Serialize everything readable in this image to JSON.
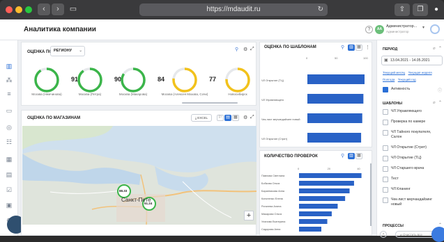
{
  "browser": {
    "url": "https://mdaudit.ru",
    "reload_icon": "reload-icon"
  },
  "header": {
    "title": "Аналитика компании",
    "help": "?",
    "avatar_initials": "AA",
    "user_name": "Администратор...",
    "user_role": "Администратор"
  },
  "region_card": {
    "title_prefix": "ОЦЕНКА ПО",
    "dropdown_value": "РЕГИОНУ",
    "gauges": [
      {
        "value": 91,
        "label": "Москва (Немчинова)",
        "color": "#3bb54a",
        "fraction": 0.91
      },
      {
        "value": 90,
        "label": "Москва (Петра)",
        "color": "#3bb54a",
        "fraction": 0.9
      },
      {
        "value": 84,
        "label": "Москва (Макарова)",
        "color": "#3bb54a",
        "fraction": 0.84
      },
      {
        "value": 77,
        "label": "Москва (Алексея Мазова, Сочи)",
        "color": "#f2c21b",
        "fraction": 0.77
      },
      {
        "value": 76,
        "label": "Новосибирск",
        "color": "#f2c21b",
        "fraction": 0.76
      }
    ]
  },
  "stores_card": {
    "title": "ОЦЕНКА ПО МАГАЗИНАМ",
    "excel_label": "EXCEL",
    "map_labels": {
      "city": "Санкт-Пете",
      "marker1": "88.33",
      "marker2": "51.24",
      "zoom_in": "+"
    }
  },
  "templates_card": {
    "title": "ОЦЕНКА ПО ШАБЛОНАМ",
    "ticks": [
      "0",
      "50",
      "100"
    ],
    "chart_data": {
      "type": "bar",
      "orientation": "horizontal",
      "categories": [
        "ЧЛ Открытие (ТЦ)",
        "ЧЛ Управляющего",
        "Чек-лист мерчандайзинг новый",
        "ЧЛ Открытие (Стрит)"
      ],
      "values": [
        100,
        98,
        96,
        94
      ],
      "xlim": [
        0,
        100
      ]
    }
  },
  "checks_card": {
    "title": "КОЛИЧЕСТВО ПРОВЕРОК",
    "ticks": [
      "0",
      "20",
      "40"
    ],
    "chart_data": {
      "type": "bar",
      "orientation": "horizontal",
      "categories": [
        "Павлова Светлана",
        "Бобкова Ольга",
        "Баранникова Анна",
        "Кононенко Елена",
        "Рогалева Алина",
        "Макарова Ольга",
        "Уланова Екатерина",
        "Сидорова Анна"
      ],
      "values": [
        42,
        37,
        34,
        31,
        26,
        22,
        19,
        15
      ],
      "xlim": [
        0,
        45
      ]
    }
  },
  "filters": {
    "period_title": "ПЕРИОД",
    "date_range": "13.04.2021 - 14.05.2021",
    "quick_links": [
      "Текущий месяц",
      "Текущая неделя",
      "Полгода",
      "Текущий год"
    ],
    "active_label": "Активность",
    "templates_title": "ШАБЛОНЫ",
    "templates": [
      "ЧЛ Управляющего",
      "Проверка по камере",
      "ЧЛ Тайного покупателя, Салон",
      "ЧЛ Открытие (Стрит)",
      "ЧЛ Открытие (ТЦ)",
      "ЧЛ Старшего врача",
      "Тест",
      "ЧЛ Кланинг",
      "Чек-лист мерчандайзинг новый"
    ],
    "processes_title": "ПРОЦЕССЫ",
    "clear_label": "Очистить все"
  },
  "colors": {
    "accent": "#2a6fd6",
    "bar": "#2962c6",
    "green": "#3bb54a",
    "yellow": "#f2c21b"
  }
}
